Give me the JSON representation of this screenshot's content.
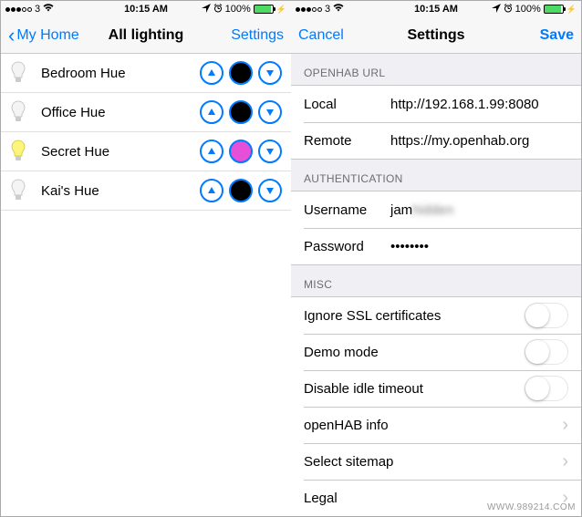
{
  "status": {
    "carrier": "3",
    "signal_filled": 3,
    "wifi": true,
    "time": "10:15 AM",
    "alarm": true,
    "location": true,
    "battery_pct": "100%",
    "charging": true
  },
  "left": {
    "nav": {
      "back": "My Home",
      "title": "All lighting",
      "action": "Settings"
    },
    "rows": [
      {
        "label": "Bedroom Hue",
        "color": "#000000",
        "bulb_on": false
      },
      {
        "label": "Office Hue",
        "color": "#000000",
        "bulb_on": false
      },
      {
        "label": "Secret Hue",
        "color": "#e64fd8",
        "bulb_on": true
      },
      {
        "label": "Kai's Hue",
        "color": "#000000",
        "bulb_on": false
      }
    ]
  },
  "right": {
    "nav": {
      "cancel": "Cancel",
      "title": "Settings",
      "save": "Save"
    },
    "sections": {
      "url_header": "OPENHAB URL",
      "local_label": "Local",
      "local_value": "http://192.168.1.99:8080",
      "remote_label": "Remote",
      "remote_value": "https://my.openhab.org",
      "auth_header": "AUTHENTICATION",
      "username_label": "Username",
      "username_value_visible": "jam",
      "username_value_hidden": "hidden",
      "password_label": "Password",
      "password_value": "••••••••",
      "misc_header": "MISC",
      "ignore_ssl": "Ignore SSL certificates",
      "demo_mode": "Demo mode",
      "disable_idle": "Disable idle timeout",
      "openhab_info": "openHAB info",
      "select_sitemap": "Select sitemap",
      "legal": "Legal"
    }
  },
  "watermark": "WWW.989214.COM"
}
